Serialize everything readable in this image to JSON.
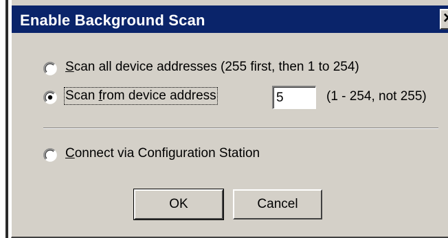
{
  "dialog": {
    "title": "Enable Background Scan",
    "close_glyph": "✕"
  },
  "options": [
    {
      "id": "scan-all",
      "mnemonic": "S",
      "label_rest": "can all device addresses (255 first, then 1 to 254)",
      "selected": false
    },
    {
      "id": "scan-from",
      "label_before": "Scan ",
      "mnemonic": "f",
      "label_rest": "rom device address",
      "selected": true
    },
    {
      "id": "config-station",
      "mnemonic": "C",
      "label_rest": "onnect via Configuration Station",
      "selected": false
    }
  ],
  "address_input": {
    "value": "5",
    "hint": "(1 - 254, not 255)"
  },
  "buttons": {
    "ok_label": "OK",
    "cancel_label": "Cancel"
  },
  "colors": {
    "titlebar": "#0a246a",
    "face": "#d4d0c8"
  }
}
